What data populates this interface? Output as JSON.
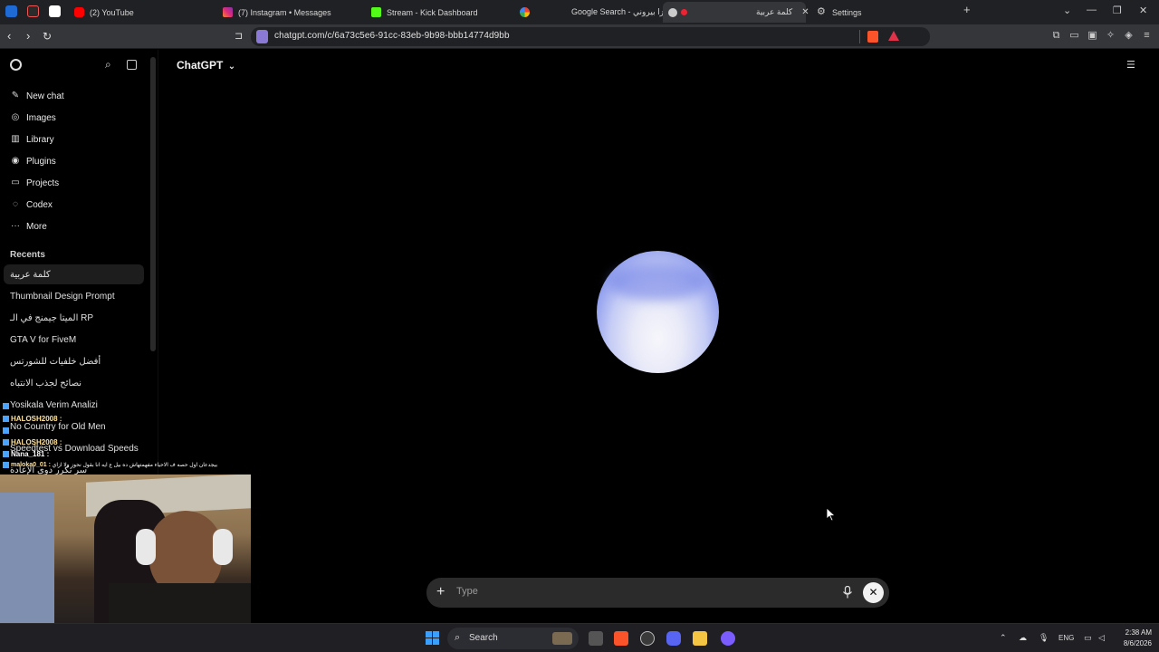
{
  "browser": {
    "tabs": [
      {
        "label": "(2) YouTube"
      },
      {
        "label": "(7) Instagram • Messages"
      },
      {
        "label": "Stream - Kick Dashboard"
      },
      {
        "label": "Google Search - بيتزا بيروني"
      },
      {
        "label": "كلمة عربية"
      },
      {
        "label": "Settings"
      }
    ],
    "new_tab": "+",
    "url": "chatgpt.com/c/6a73c5e6-91cc-83eb-9b98-bbb14774d9bb"
  },
  "sidebar": {
    "items": [
      {
        "label": "New chat",
        "icon": "new-chat-icon"
      },
      {
        "label": "Images",
        "icon": "images-icon"
      },
      {
        "label": "Library",
        "icon": "library-icon"
      },
      {
        "label": "Plugins",
        "icon": "plugins-icon"
      },
      {
        "label": "Projects",
        "icon": "projects-icon"
      },
      {
        "label": "Codex",
        "icon": "codex-icon"
      },
      {
        "label": "More",
        "icon": "more-icon"
      }
    ],
    "recents_title": "Recents",
    "recents": [
      "كلمة عربية",
      "Thumbnail Design Prompt",
      "الميتا جيمنج في الـ RP",
      "GTA V for FiveM",
      "أفضل خلفيات للشورتس",
      "نصائح لجذب الانتباه",
      "Yosikala Verim Analizi",
      "No Country for Old Men",
      "Speedtest vs Download Speeds",
      "سر تكرر دوى الإعادة"
    ]
  },
  "main": {
    "title": "ChatGPT",
    "composer_placeholder": "Type"
  },
  "overlay_chat": [
    {
      "user": "HALOSH2008 :"
    },
    {
      "user": "HALOSH2008 :"
    },
    {
      "user": "Nana_181 :"
    },
    {
      "user": "maloka0_01 :"
    }
  ],
  "overlay_long_message": "بيجدعان اول حصه ف الاحياء مفهمتهاش ده بيل ع ايه انا بقول نحوز ولا ازاي",
  "taskbar": {
    "search_label": "Search",
    "lang": "ENG",
    "time": "2:38 AM",
    "date": "8/6/2026"
  },
  "colors": {
    "background": "#000000",
    "orb_light": "#f6f6fb",
    "orb_blue": "#6d7de6",
    "composer": "#2b2b2b"
  }
}
